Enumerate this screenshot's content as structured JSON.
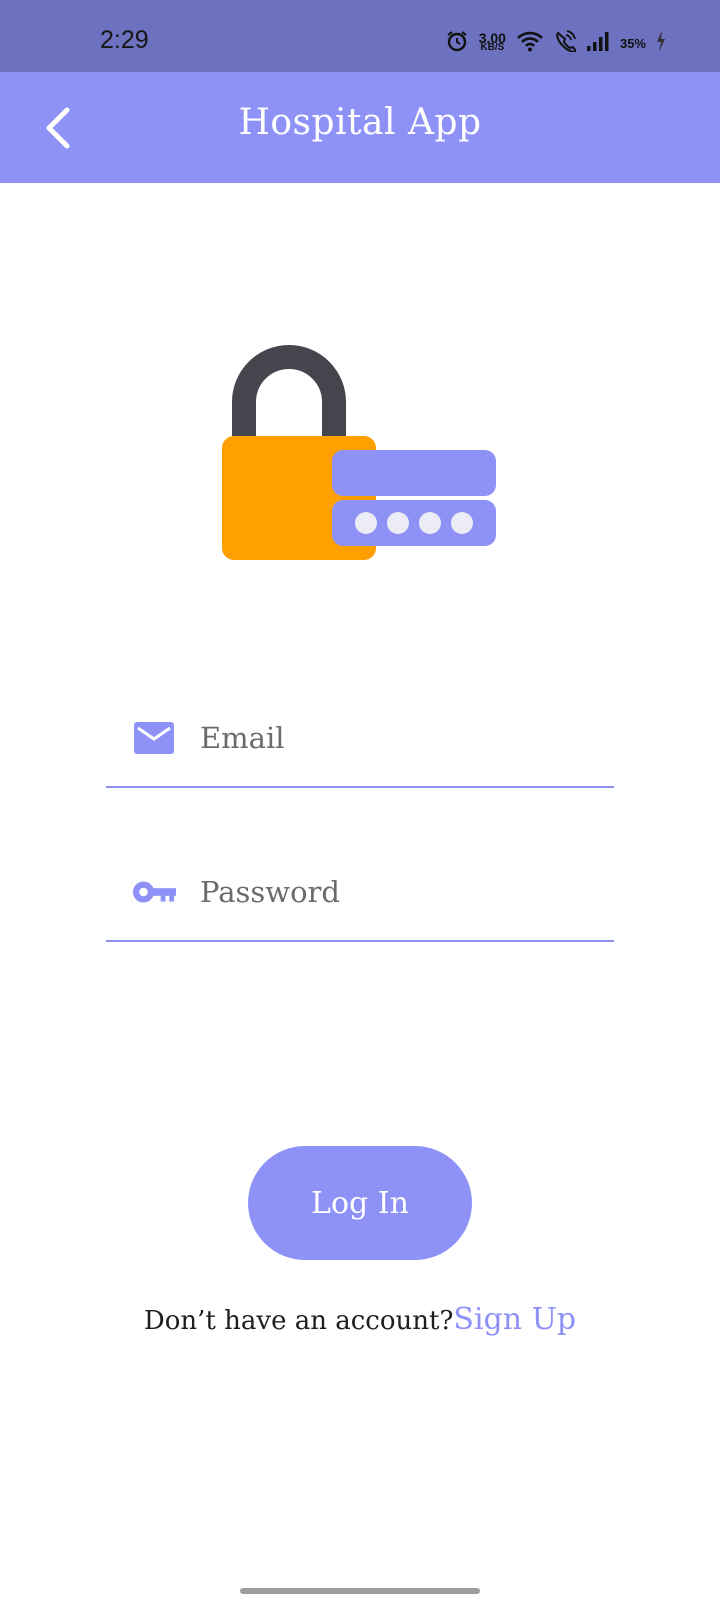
{
  "status_bar": {
    "time": "2:29",
    "speed_value": "3.00",
    "speed_unit": "KB/S",
    "battery": "35%"
  },
  "app_bar": {
    "title": "Hospital App"
  },
  "form": {
    "email_placeholder": "Email",
    "password_placeholder": "Password",
    "login_label": "Log In"
  },
  "signup": {
    "prompt": "Don’t have an account?",
    "link": "Sign Up"
  },
  "colors": {
    "accent": "#8e92f7",
    "status_bar": "#6c72bf",
    "lock_body": "#ffa000",
    "lock_shackle": "#45454d"
  }
}
